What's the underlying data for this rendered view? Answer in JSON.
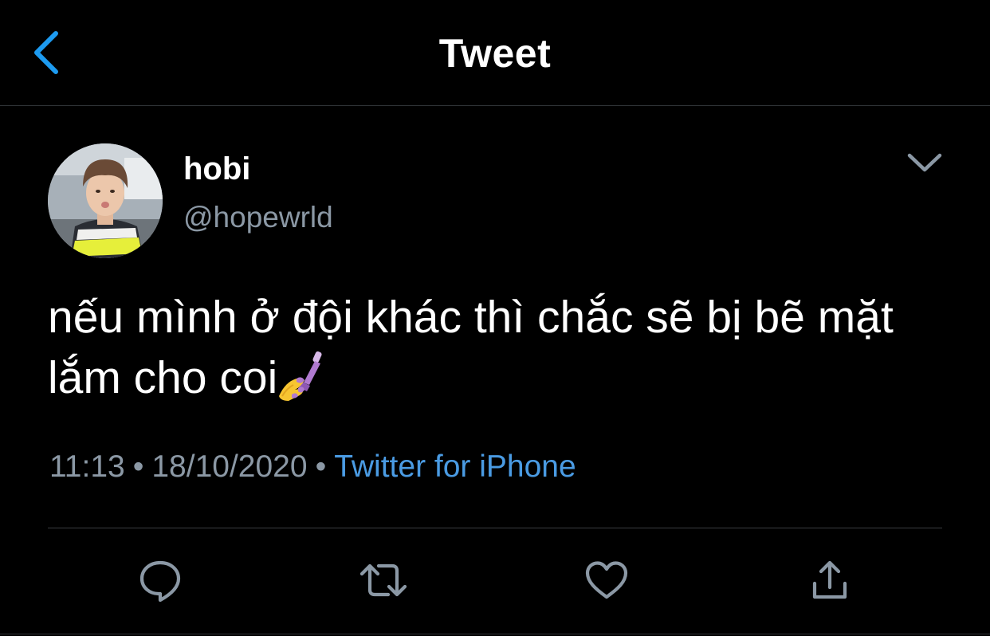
{
  "header": {
    "title": "Tweet",
    "back_icon": "chevron-left-icon"
  },
  "tweet": {
    "author": {
      "display_name": "hobi",
      "handle": "@hopewrld"
    },
    "text": "nếu mình ở đội khác thì chắc sẽ bị bẽ mặt lắm cho coi",
    "emoji": "nail-polish-emoji",
    "time": "11:13",
    "date": "18/10/2020",
    "separator": "•",
    "source": "Twitter for iPhone"
  },
  "actions": [
    {
      "name": "reply",
      "icon": "reply-icon"
    },
    {
      "name": "retweet",
      "icon": "retweet-icon"
    },
    {
      "name": "like",
      "icon": "heart-icon"
    },
    {
      "name": "share",
      "icon": "share-icon"
    }
  ],
  "colors": {
    "background": "#000000",
    "text_primary": "#ffffff",
    "text_secondary": "#8b98a5",
    "accent": "#1d9bf0",
    "link": "#4a9be3",
    "divider": "#2f3336"
  }
}
